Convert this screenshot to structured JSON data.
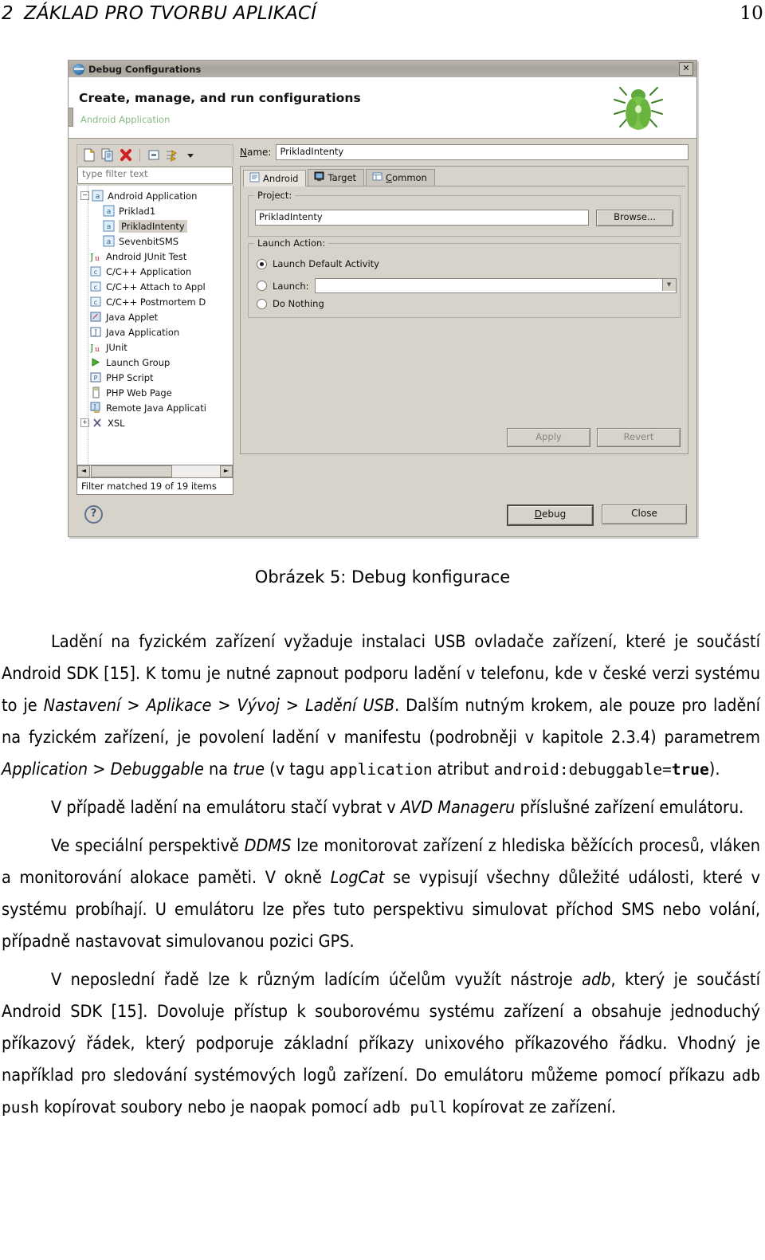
{
  "runhead": {
    "section_number": "2",
    "section_title": "ZÁKLAD PRO TVORBU APLIKACÍ",
    "page_number": "10"
  },
  "figure": {
    "caption": "Obrázek 5: Debug konfigurace",
    "dialog": {
      "titlebar": {
        "title": "Debug Configurations",
        "close_label": "✕",
        "icon": "eclipse-debug-icon"
      },
      "banner": {
        "heading": "Create, manage, and run configurations",
        "subheading": "Android Application",
        "icon": "green-bug-icon"
      },
      "toolbar": {
        "buttons": [
          {
            "name": "new-launch-configuration",
            "icon": "new-document-icon"
          },
          {
            "name": "duplicate-configuration",
            "icon": "copy-icon"
          },
          {
            "name": "delete-configuration",
            "icon": "red-x-icon"
          },
          {
            "name": "collapse-all",
            "icon": "collapse-all-icon"
          },
          {
            "name": "filter-configurations",
            "icon": "filter-arrows-icon"
          },
          {
            "name": "toolbar-menu",
            "icon": "chevron-down-icon"
          }
        ]
      },
      "filter": {
        "placeholder": "type filter text",
        "value": ""
      },
      "tree": {
        "items": [
          {
            "label": "Android Application",
            "icon": "android-config-icon",
            "depth": 0,
            "expander": "−",
            "selected": false
          },
          {
            "label": "Priklad1",
            "icon": "android-config-icon",
            "depth": 1,
            "expander": "",
            "selected": false
          },
          {
            "label": "PrikladIntenty",
            "icon": "android-config-icon",
            "depth": 1,
            "expander": "",
            "selected": true
          },
          {
            "label": "SevenbitSMS",
            "icon": "android-config-icon",
            "depth": 1,
            "expander": "",
            "selected": false
          },
          {
            "label": "Android JUnit Test",
            "icon": "junit-android-icon",
            "depth": 0,
            "expander": "",
            "selected": false
          },
          {
            "label": "C/C++ Application",
            "icon": "c-app-icon",
            "depth": 0,
            "expander": "",
            "selected": false
          },
          {
            "label": "C/C++ Attach to Appl",
            "icon": "c-app-icon",
            "depth": 0,
            "expander": "",
            "selected": false
          },
          {
            "label": "C/C++ Postmortem D",
            "icon": "c-app-icon",
            "depth": 0,
            "expander": "",
            "selected": false
          },
          {
            "label": "Java Applet",
            "icon": "java-applet-icon",
            "depth": 0,
            "expander": "",
            "selected": false
          },
          {
            "label": "Java Application",
            "icon": "java-app-icon",
            "depth": 0,
            "expander": "",
            "selected": false
          },
          {
            "label": "JUnit",
            "icon": "junit-icon",
            "depth": 0,
            "expander": "",
            "selected": false
          },
          {
            "label": "Launch Group",
            "icon": "green-play-icon",
            "depth": 0,
            "expander": "",
            "selected": false
          },
          {
            "label": "PHP Script",
            "icon": "php-script-icon",
            "depth": 0,
            "expander": "",
            "selected": false
          },
          {
            "label": "PHP Web Page",
            "icon": "php-web-icon",
            "depth": 0,
            "expander": "",
            "selected": false
          },
          {
            "label": "Remote Java Applicati",
            "icon": "remote-java-icon",
            "depth": 0,
            "expander": "",
            "selected": false
          },
          {
            "label": "XSL",
            "icon": "xsl-icon",
            "depth": 0,
            "expander": "+",
            "selected": false
          }
        ],
        "scroll_left_arrow": "◄",
        "scroll_right_arrow": "►",
        "status": "Filter matched 19 of 19 items"
      },
      "name_field": {
        "label": "Name:",
        "label_mnemonic": "N",
        "value": "PrikladIntenty"
      },
      "tabs": [
        {
          "label": "Android",
          "icon": "android-tab-icon",
          "active": true
        },
        {
          "label": "Target",
          "icon": "target-device-icon",
          "active": false
        },
        {
          "label": "Common",
          "icon": "common-tab-icon",
          "active": false,
          "mnemonic": "C"
        }
      ],
      "project_group": {
        "label": "Project:",
        "value": "PrikladIntenty",
        "browse_button": "Browse..."
      },
      "launch_action_group": {
        "label": "Launch Action:",
        "options": [
          {
            "label": "Launch Default Activity",
            "selected": true
          },
          {
            "label": "Launch:",
            "selected": false,
            "combo_value": ""
          },
          {
            "label": "Do Nothing",
            "selected": false
          }
        ]
      },
      "footer": {
        "apply_button": "Apply",
        "revert_button": "Revert",
        "revert_mnemonic": "v",
        "help_icon": "question-mark-icon",
        "debug_button": "Debug",
        "debug_mnemonic": "D",
        "close_button": "Close"
      }
    }
  },
  "prose": {
    "p1_a": "Ladění na fyzickém zařízení vyžaduje instalaci USB ovladače zařízení, které je součástí Android SDK [15]. K tomu je nutné zapnout podporu ladění v telefonu, kde v české verzi systému to je ",
    "p1_i1": "Nastavení > Aplikace > Vývoj > Ladění USB",
    "p1_b": ". Dalším nutným krokem, ale pouze pro ladění na fyzickém zařízení, je povolení ladění v manifestu (podrobněji v kapitole 2.3.4) parametrem ",
    "p1_i2": "Application > Debuggable",
    "p1_c": " na ",
    "p1_i3": "true",
    "p1_d": " (v tagu ",
    "p1_m1": "application",
    "p1_e": " atribut ",
    "p1_m2": "android:debuggable=",
    "p1_m3": "true",
    "p1_f": ").",
    "p2_a": "V případě ladění na emulátoru stačí vybrat v ",
    "p2_i1": "AVD Manageru",
    "p2_b": " příslušné zařízení emulátoru.",
    "p3_a": "Ve speciální perspektivě ",
    "p3_i1": "DDMS",
    "p3_b": " lze monitorovat zařízení z hlediska běžících procesů, vláken a monitorování alokace paměti. V okně ",
    "p3_i2": "LogCat",
    "p3_c": " se vypisují všechny důležité události, které v systému probíhají. U emulátoru lze přes tuto perspektivu simulovat příchod SMS nebo volání, případně nastavovat simulovanou pozici GPS.",
    "p4_a": "V neposlední řadě lze k různým ladícím účelům využít nástroje ",
    "p4_i1": "adb",
    "p4_b": ", který je součástí Android SDK [15]. Dovoluje přístup k souborovému systému zařízení a obsahuje jednoduchý příkazový řádek, který podporuje základní příkazy unixového příkazového řádku. Vhodný je například pro sledování systémových logů zařízení. Do emulátoru můžeme pomocí příkazu ",
    "p4_m1": "adb push",
    "p4_c": " kopírovat soubory nebo je naopak pomocí ",
    "p4_m2": "adb pull",
    "p4_d": " kopírovat ze zařízení."
  }
}
